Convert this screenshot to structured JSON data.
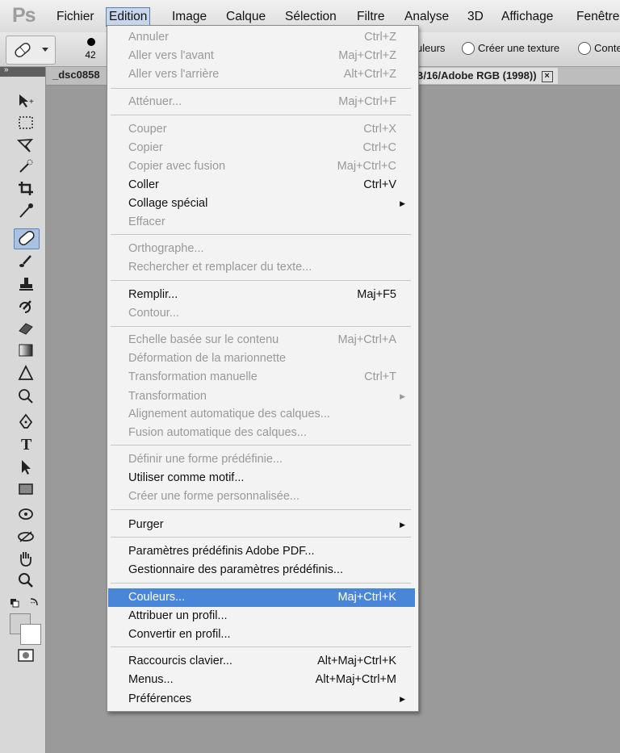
{
  "app": {
    "logo": "Ps"
  },
  "menubar": {
    "items": [
      "Fichier",
      "Edition",
      "Image",
      "Calque",
      "Sélection",
      "Filtre",
      "Analyse",
      "3D",
      "Affichage",
      "Fenêtre"
    ]
  },
  "options": {
    "brush_size": "42",
    "radio_couleurs": "uleurs",
    "radio_texture": "Créer une texture",
    "radio_conte": "Conte"
  },
  "document": {
    "tab_left": "_dsc0858",
    "tab_right": "B/16/Adobe RGB (1998))",
    "close_glyph": "×"
  },
  "tools_panel": {
    "collapse_glyph": "»"
  },
  "edit_menu": {
    "items": [
      {
        "label": "Annuler",
        "shortcut": "Ctrl+Z",
        "enabled": false
      },
      {
        "label": "Aller vers l'avant",
        "shortcut": "Maj+Ctrl+Z",
        "enabled": false
      },
      {
        "label": "Aller vers l'arrière",
        "shortcut": "Alt+Ctrl+Z",
        "enabled": false
      },
      {
        "label": "Atténuer...",
        "shortcut": "Maj+Ctrl+F",
        "enabled": false
      },
      {
        "label": "Couper",
        "shortcut": "Ctrl+X",
        "enabled": false
      },
      {
        "label": "Copier",
        "shortcut": "Ctrl+C",
        "enabled": false
      },
      {
        "label": "Copier avec fusion",
        "shortcut": "Maj+Ctrl+C",
        "enabled": false
      },
      {
        "label": "Coller",
        "shortcut": "Ctrl+V",
        "enabled": true
      },
      {
        "label": "Collage spécial",
        "shortcut": "",
        "enabled": true,
        "submenu": true
      },
      {
        "label": "Effacer",
        "shortcut": "",
        "enabled": false
      },
      {
        "label": "Orthographe...",
        "shortcut": "",
        "enabled": false
      },
      {
        "label": "Rechercher et remplacer du texte...",
        "shortcut": "",
        "enabled": false
      },
      {
        "label": "Remplir...",
        "shortcut": "Maj+F5",
        "enabled": true
      },
      {
        "label": "Contour...",
        "shortcut": "",
        "enabled": false
      },
      {
        "label": "Echelle basée sur le contenu",
        "shortcut": "Maj+Ctrl+A",
        "enabled": false
      },
      {
        "label": "Déformation de la marionnette",
        "shortcut": "",
        "enabled": false
      },
      {
        "label": "Transformation manuelle",
        "shortcut": "Ctrl+T",
        "enabled": false
      },
      {
        "label": "Transformation",
        "shortcut": "",
        "enabled": false,
        "submenu": true
      },
      {
        "label": "Alignement automatique des calques...",
        "shortcut": "",
        "enabled": false
      },
      {
        "label": "Fusion automatique des calques...",
        "shortcut": "",
        "enabled": false
      },
      {
        "label": "Définir une forme prédéfinie...",
        "shortcut": "",
        "enabled": false
      },
      {
        "label": "Utiliser comme motif...",
        "shortcut": "",
        "enabled": true
      },
      {
        "label": "Créer une forme personnalisée...",
        "shortcut": "",
        "enabled": false
      },
      {
        "label": "Purger",
        "shortcut": "",
        "enabled": true,
        "submenu": true
      },
      {
        "label": "Paramètres prédéfinis Adobe PDF...",
        "shortcut": "",
        "enabled": true
      },
      {
        "label": "Gestionnaire des paramètres prédéfinis...",
        "shortcut": "",
        "enabled": true
      },
      {
        "label": "Couleurs...",
        "shortcut": "Maj+Ctrl+K",
        "enabled": true,
        "highlighted": true
      },
      {
        "label": "Attribuer un profil...",
        "shortcut": "",
        "enabled": true
      },
      {
        "label": "Convertir en profil...",
        "shortcut": "",
        "enabled": true
      },
      {
        "label": "Raccourcis clavier...",
        "shortcut": "Alt+Maj+Ctrl+K",
        "enabled": true
      },
      {
        "label": "Menus...",
        "shortcut": "Alt+Maj+Ctrl+M",
        "enabled": true
      },
      {
        "label": "Préférences",
        "shortcut": "",
        "enabled": true,
        "submenu": true
      }
    ]
  },
  "colors": {
    "highlight": "#4a86d8",
    "disabled_text": "#999999",
    "workspace": "#9a9a9a"
  }
}
